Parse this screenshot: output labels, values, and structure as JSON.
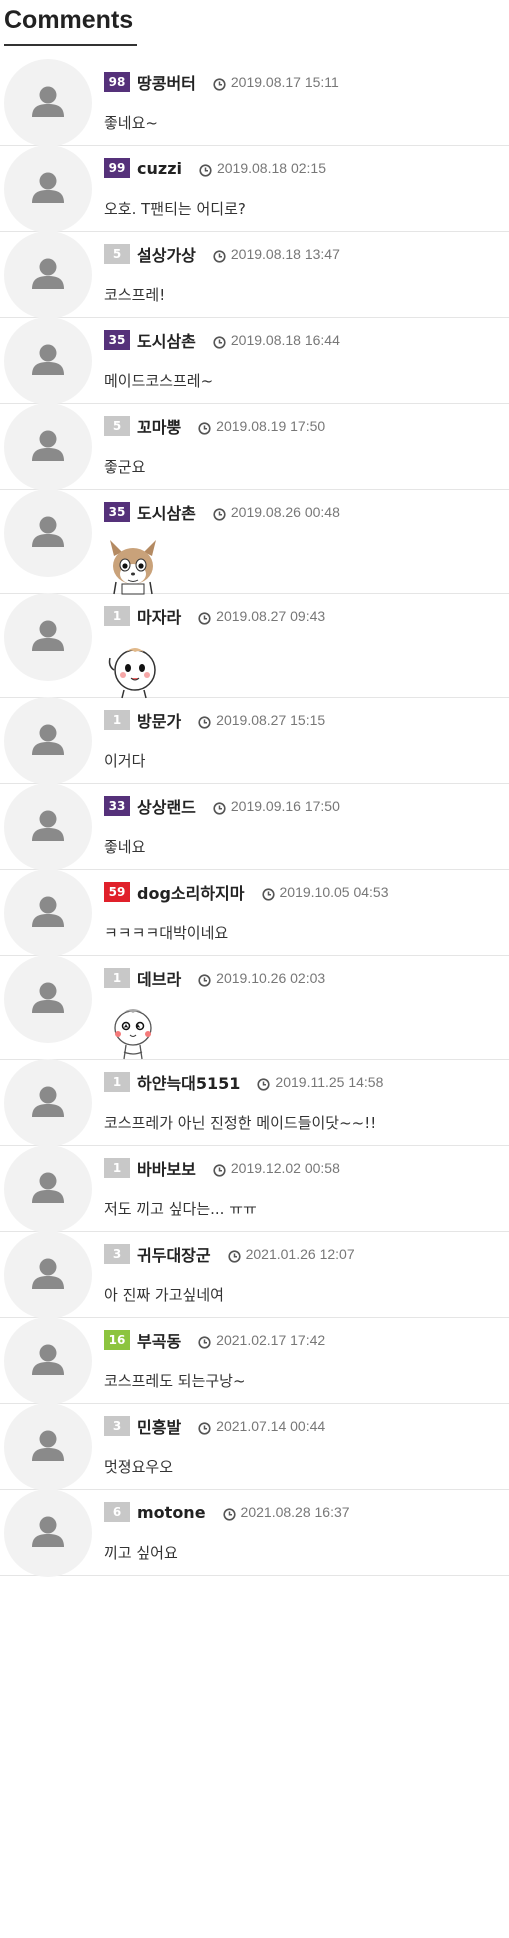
{
  "section_title": "Comments",
  "colors": {
    "level_purple": "#55317a",
    "level_gray": "#c8c8c8",
    "level_red": "#e0202a",
    "level_green": "#8cc43f",
    "avatar_bg": "#f2f2f2",
    "avatar_icon": "#8a8a8a"
  },
  "comments": [
    {
      "level": "98",
      "level_color": "#55317a",
      "author": "땅콩버터",
      "date": "2019.08.17 15:11",
      "text": "좋네요~"
    },
    {
      "level": "99",
      "level_color": "#55317a",
      "author": "cuzzi",
      "date": "2019.08.18 02:15",
      "text": "오호. T팬티는 어디로?"
    },
    {
      "level": "5",
      "level_color": "#c8c8c8",
      "author": "설상가상",
      "date": "2019.08.18 13:47",
      "text": "코스프레!"
    },
    {
      "level": "35",
      "level_color": "#55317a",
      "author": "도시삼촌",
      "date": "2019.08.18 16:44",
      "text": "메이드코스프레~"
    },
    {
      "level": "5",
      "level_color": "#c8c8c8",
      "author": "꼬마뿡",
      "date": "2019.08.19 17:50",
      "text": "좋군요"
    },
    {
      "level": "35",
      "level_color": "#55317a",
      "author": "도시삼촌",
      "date": "2019.08.26 00:48",
      "text": "",
      "emoticon": "deer-emoticon"
    },
    {
      "level": "1",
      "level_color": "#c8c8c8",
      "author": "마자라",
      "date": "2019.08.27 09:43",
      "text": "",
      "emoticon": "waving-character-emoticon"
    },
    {
      "level": "1",
      "level_color": "#c8c8c8",
      "author": "방문가",
      "date": "2019.08.27 15:15",
      "text": "이거다"
    },
    {
      "level": "33",
      "level_color": "#55317a",
      "author": "상상랜드",
      "date": "2019.09.16 17:50",
      "text": "좋네요"
    },
    {
      "level": "59",
      "level_color": "#e0202a",
      "author": "dog소리하지마",
      "date": "2019.10.05 04:53",
      "text": "ㅋㅋㅋㅋ대박이네요"
    },
    {
      "level": "1",
      "level_color": "#c8c8c8",
      "author": "데브라",
      "date": "2019.10.26 02:03",
      "text": "",
      "emoticon": "star-eyes-character-emoticon"
    },
    {
      "level": "1",
      "level_color": "#c8c8c8",
      "author": "하얀늑대5151",
      "date": "2019.11.25 14:58",
      "text": "코스프레가 아닌 진정한 메이드들이닷~~!!"
    },
    {
      "level": "1",
      "level_color": "#c8c8c8",
      "author": "바바보보",
      "date": "2019.12.02 00:58",
      "text": "저도 끼고 싶다는... ㅠㅠ"
    },
    {
      "level": "3",
      "level_color": "#c8c8c8",
      "author": "귀두대장군",
      "date": "2021.01.26 12:07",
      "text": "아 진짜 가고싶네여"
    },
    {
      "level": "16",
      "level_color": "#8cc43f",
      "author": "부곡동",
      "date": "2021.02.17 17:42",
      "text": "코스프레도 되는구낭~"
    },
    {
      "level": "3",
      "level_color": "#c8c8c8",
      "author": "민흥발",
      "date": "2021.07.14 00:44",
      "text": "멋졍요우오"
    },
    {
      "level": "6",
      "level_color": "#c8c8c8",
      "author": "motone",
      "date": "2021.08.28 16:37",
      "text": "끼고 싶어요"
    }
  ]
}
